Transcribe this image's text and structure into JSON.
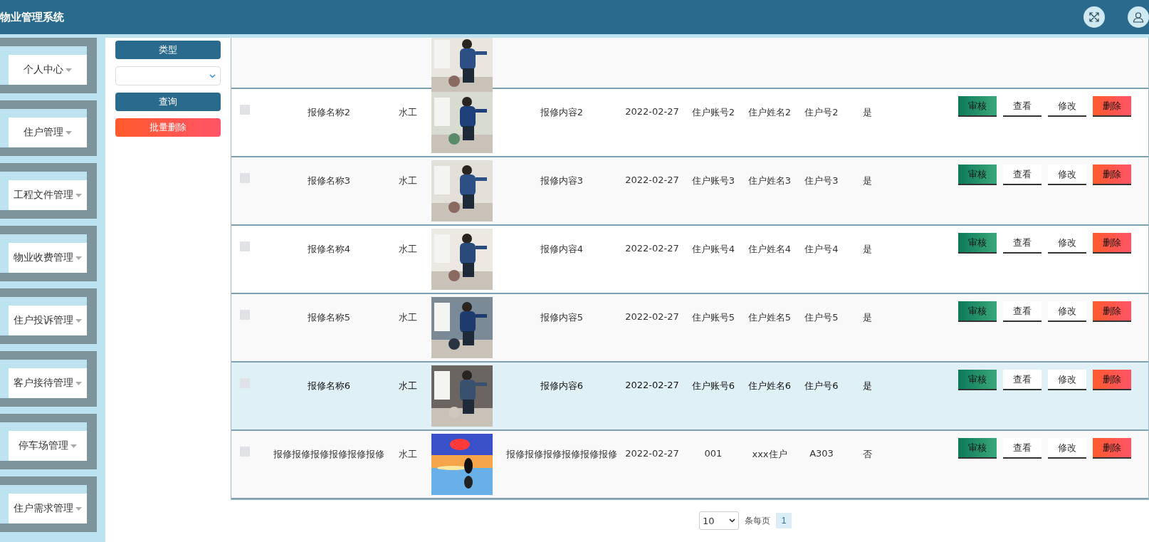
{
  "header": {
    "title": "物业管理系统"
  },
  "sidebar": {
    "items": [
      {
        "label": "个人中心"
      },
      {
        "label": "住户管理"
      },
      {
        "label": "工程文件管理"
      },
      {
        "label": "物业收费管理"
      },
      {
        "label": "住户投诉管理"
      },
      {
        "label": "客户接待管理"
      },
      {
        "label": "停车场管理"
      },
      {
        "label": "住户需求管理"
      }
    ]
  },
  "filter": {
    "label": "类型",
    "search_button": "查询",
    "batch_delete_button": "批量删除"
  },
  "table": {
    "rows": [
      {
        "kind": "clipped",
        "highlighted": false
      },
      {
        "kind": "full",
        "checked": false,
        "highlighted": false,
        "name": "报修名称2",
        "type": "水工",
        "content": "报修内容2",
        "date": "2022-02-27",
        "account": "住户账号2",
        "owner": "住户姓名2",
        "room": "住户号2",
        "reviewed": "是",
        "actions": [
          "审核",
          "查看",
          "修改",
          "删除"
        ]
      },
      {
        "kind": "full",
        "checked": false,
        "highlighted": false,
        "name": "报修名称3",
        "type": "水工",
        "content": "报修内容3",
        "date": "2022-02-27",
        "account": "住户账号3",
        "owner": "住户姓名3",
        "room": "住户号3",
        "reviewed": "是",
        "actions": [
          "审核",
          "查看",
          "修改",
          "删除"
        ]
      },
      {
        "kind": "full",
        "checked": false,
        "highlighted": false,
        "name": "报修名称4",
        "type": "水工",
        "content": "报修内容4",
        "date": "2022-02-27",
        "account": "住户账号4",
        "owner": "住户姓名4",
        "room": "住户号4",
        "reviewed": "是",
        "actions": [
          "审核",
          "查看",
          "修改",
          "删除"
        ]
      },
      {
        "kind": "full",
        "checked": false,
        "highlighted": false,
        "name": "报修名称5",
        "type": "水工",
        "content": "报修内容5",
        "date": "2022-02-27",
        "account": "住户账号5",
        "owner": "住户姓名5",
        "room": "住户号5",
        "reviewed": "是",
        "actions": [
          "审核",
          "查看",
          "修改",
          "删除"
        ]
      },
      {
        "kind": "full",
        "checked": false,
        "highlighted": true,
        "name": "报修名称6",
        "type": "水工",
        "content": "报修内容6",
        "date": "2022-02-27",
        "account": "住户账号6",
        "owner": "住户姓名6",
        "room": "住户号6",
        "reviewed": "是",
        "actions": [
          "审核",
          "查看",
          "修改",
          "删除"
        ]
      },
      {
        "kind": "full",
        "checked": false,
        "highlighted": false,
        "name": "报修报修报修报修报修报修",
        "type": "水工",
        "content": "报修报修报修报修报修报修",
        "date": "2022-02-27",
        "account": "001",
        "owner": "xxx住户",
        "room": "A303",
        "reviewed": "否",
        "actions": [
          "审核",
          "查看",
          "修改",
          "删除"
        ]
      }
    ]
  },
  "pagination": {
    "page_size": "10",
    "page_size_label": "条每页",
    "pages": [
      {
        "label": "1",
        "selected": true
      }
    ]
  }
}
